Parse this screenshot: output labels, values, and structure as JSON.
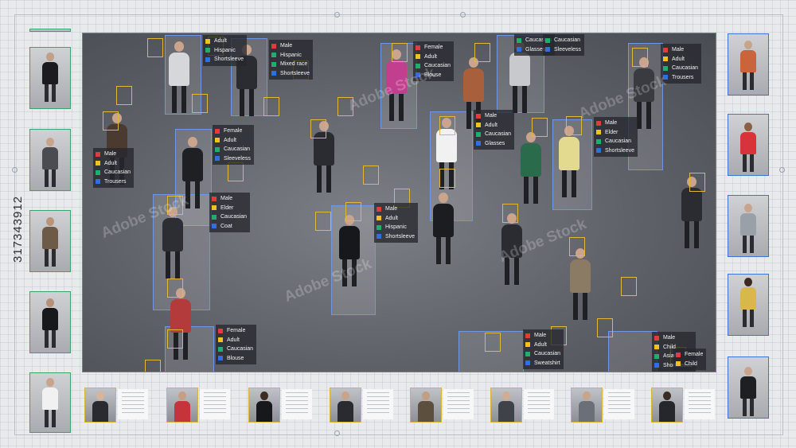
{
  "stock_id": "317343912",
  "watermark_text": "Adobe Stock",
  "colors": {
    "gender_marker": "#e23b3b",
    "age_marker": "#f0c21e",
    "ethnicity_marker": "#1fae6e",
    "clothing_marker": "#2f6fe0",
    "viewport_border": "#e2585a",
    "face_box": "#e2b73a",
    "body_box": "#6f96e6"
  },
  "detections": [
    {
      "id": "d1",
      "labels": [
        "Male",
        "Hispanic",
        "Mixed race",
        "Shortsleeve"
      ]
    },
    {
      "id": "d2",
      "labels": [
        "Adult",
        "Hispanic",
        "Shortsleeve"
      ]
    },
    {
      "id": "d3",
      "labels": [
        "Female",
        "Adult",
        "Caucasian",
        "Blouse"
      ]
    },
    {
      "id": "d4",
      "labels": [
        "Caucasian",
        "Glasses"
      ]
    },
    {
      "id": "d5",
      "labels": [
        "Caucasian",
        "Sleeveless"
      ]
    },
    {
      "id": "d6",
      "labels": [
        "Male",
        "Adult",
        "Caucasian",
        "Trousers"
      ]
    },
    {
      "id": "d7",
      "labels": [
        "Male",
        "Adult",
        "Caucasian",
        "Trousers"
      ]
    },
    {
      "id": "d8",
      "labels": [
        "Female",
        "Adult",
        "Caucasian",
        "Sleeveless"
      ]
    },
    {
      "id": "d9",
      "labels": [
        "Male",
        "Adult",
        "Caucasian",
        "Glasses"
      ]
    },
    {
      "id": "d10",
      "labels": [
        "Male",
        "Elder",
        "Caucasian",
        "Shortsleeve"
      ]
    },
    {
      "id": "d11",
      "labels": [
        "Male",
        "Elder",
        "Caucasian",
        "Coat"
      ]
    },
    {
      "id": "d12",
      "labels": [
        "Male",
        "Adult",
        "Hispanic",
        "Shortsleeve"
      ]
    },
    {
      "id": "d13",
      "labels": [
        "Female",
        "Adult",
        "Caucasian",
        "Blouse"
      ]
    },
    {
      "id": "d14",
      "labels": [
        "Male",
        "Adult",
        "Caucasian",
        "Sweatshirt"
      ]
    },
    {
      "id": "d15",
      "labels": [
        "Male",
        "Child",
        "Asian",
        "Shortsleeve"
      ]
    },
    {
      "id": "d16",
      "labels": [
        "Female",
        "Child"
      ]
    }
  ]
}
